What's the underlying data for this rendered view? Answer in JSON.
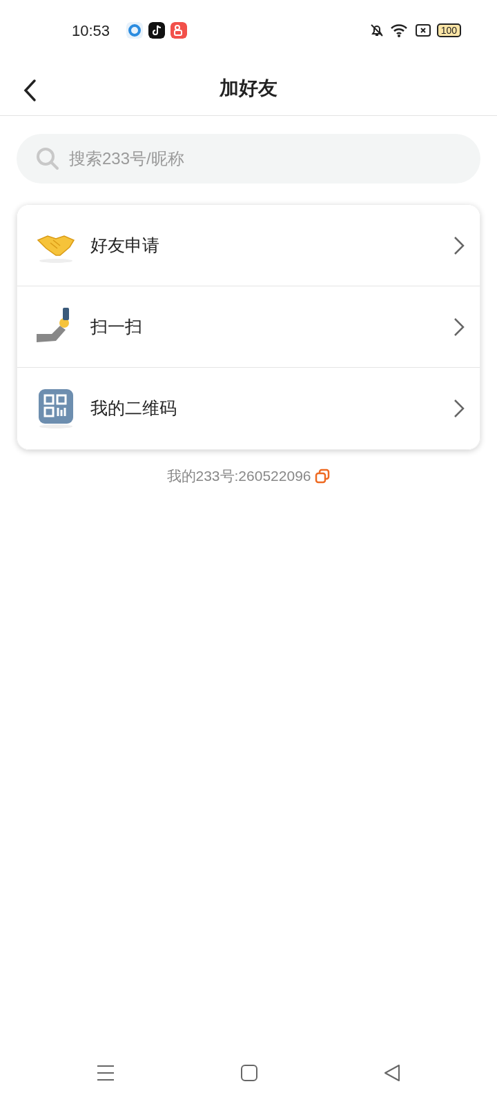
{
  "status_bar": {
    "time": "10:53",
    "battery": "100"
  },
  "header": {
    "title": "加好友"
  },
  "search": {
    "placeholder": "搜索233号/昵称"
  },
  "menu": [
    {
      "kind": "handshake",
      "label": "好友申请"
    },
    {
      "kind": "scan",
      "label": "扫一扫"
    },
    {
      "kind": "qrcode",
      "label": "我的二维码"
    }
  ],
  "my_id": "我的233号:260522096"
}
